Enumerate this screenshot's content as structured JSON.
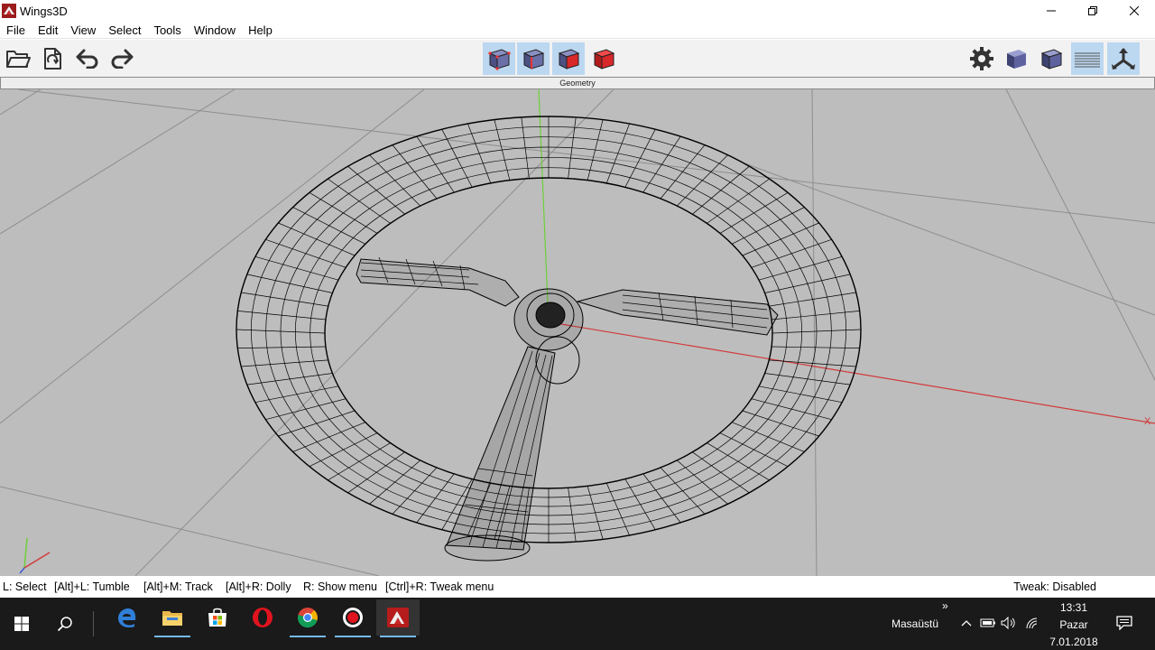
{
  "window": {
    "title": "Wings3D",
    "controls": [
      "minimize-icon",
      "restore-icon",
      "close-icon"
    ]
  },
  "menu": {
    "file": "File",
    "edit": "Edit",
    "view": "View",
    "select": "Select",
    "tools": "Tools",
    "window": "Window",
    "help": "Help"
  },
  "toolbar": {
    "left_icons": [
      "open-folder-icon",
      "import-icon",
      "undo-icon",
      "redo-icon"
    ],
    "selection_modes": [
      "vertex-mode-icon",
      "edge-mode-icon",
      "face-mode-icon",
      "object-mode-icon"
    ],
    "right_icons": [
      "settings-gear-icon",
      "smooth-shade-icon",
      "wireframe-shade-icon",
      "ground-plane-icon",
      "axes-toggle-icon"
    ],
    "colors": {
      "active_bg": "#bcd7f0",
      "cube_blue": "#5a5f8f",
      "cube_red": "#d8282a"
    }
  },
  "viewport": {
    "title": "Geometry",
    "axis_x_label": "X",
    "colors": {
      "background": "#bdbdbd",
      "x_axis": "#d23a3a",
      "y_axis": "#6fcf3a",
      "grid": "#8e8e8e",
      "wire": "#000000"
    }
  },
  "status": {
    "hints": [
      "L: Select",
      "[Alt]+L: Tumble",
      "[Alt]+M: Track",
      "[Alt]+R: Dolly",
      "R: Show menu",
      "[Ctrl]+R: Tweak menu"
    ],
    "tweak": "Tweak: Disabled"
  },
  "taskbar": {
    "apps": [
      "edge-icon",
      "file-explorer-icon",
      "store-icon",
      "opera-icon",
      "chrome-icon",
      "recorder-icon",
      "wings3d-icon"
    ],
    "desktop_label": "Masaüstü",
    "tray_expand": "»",
    "tray_icons": [
      "show-hidden-icon",
      "battery-icon",
      "volume-icon",
      "network-icon"
    ],
    "clock": {
      "time": "13:31",
      "day": "Pazar",
      "date": "7.01.2018"
    }
  }
}
